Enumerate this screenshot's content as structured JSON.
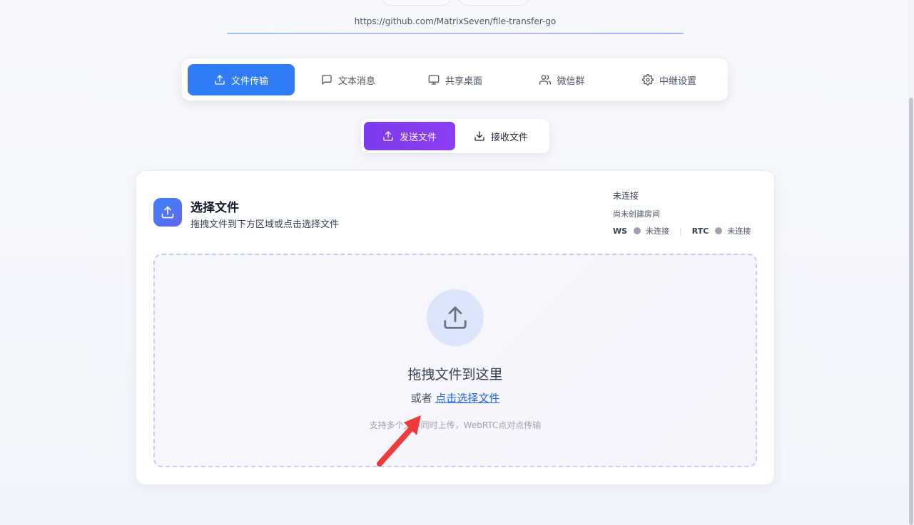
{
  "header": {
    "repo_url": "https://github.com/MatrixSeven/file-transfer-go"
  },
  "main_tabs": [
    {
      "label": "文件传输",
      "icon": "upload-icon",
      "active": true
    },
    {
      "label": "文本消息",
      "icon": "message-icon",
      "active": false
    },
    {
      "label": "共享桌面",
      "icon": "monitor-icon",
      "active": false
    },
    {
      "label": "微信群",
      "icon": "users-icon",
      "active": false
    },
    {
      "label": "中继设置",
      "icon": "gear-icon",
      "active": false
    }
  ],
  "sub_tabs": [
    {
      "label": "发送文件",
      "icon": "upload-icon",
      "active": true
    },
    {
      "label": "接收文件",
      "icon": "download-icon",
      "active": false
    }
  ],
  "card": {
    "title": "选择文件",
    "subtitle": "拖拽文件到下方区域或点击选择文件",
    "status": {
      "connection": "未连接",
      "room": "尚未创建房间",
      "ws_label": "WS",
      "ws_state": "未连接",
      "rtc_label": "RTC",
      "rtc_state": "未连接"
    },
    "drop_zone": {
      "title": "拖拽文件到这里",
      "or_text": "或者",
      "link_text": "点击选择文件",
      "hint": "支持多个文件同时上传，WebRTC点对点传输"
    }
  },
  "colors": {
    "primary_blue": "#2f7cf6",
    "accent_purple": "#7c3aed",
    "link_blue": "#2563eb",
    "annotation_red": "#ef3b3b"
  }
}
